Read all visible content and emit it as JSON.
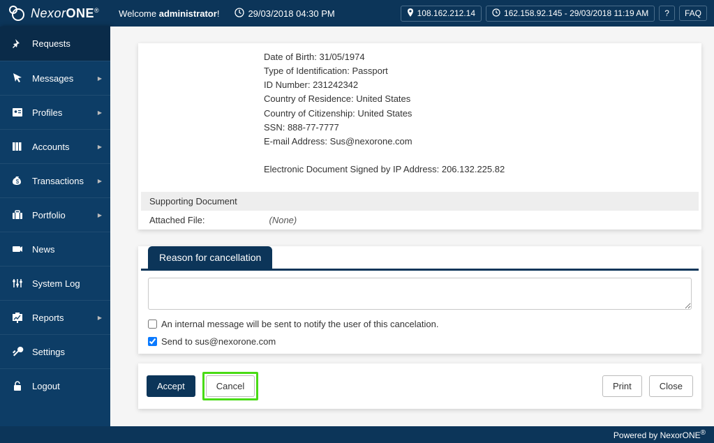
{
  "brand": {
    "name_a": "Nexor",
    "name_b": "ONE",
    "reg": "®"
  },
  "header": {
    "welcome_prefix": "Welcome ",
    "welcome_user": "administrator",
    "welcome_suffix": "!",
    "datetime": "29/03/2018 04:30 PM",
    "ip1": "108.162.212.14",
    "ip2": "162.158.92.145 - 29/03/2018 11:19 AM",
    "help": "?",
    "faq": "FAQ"
  },
  "sidebar": {
    "items": [
      {
        "label": "Requests",
        "icon": "thumbtack",
        "chevron": false,
        "active": true
      },
      {
        "label": "Messages",
        "icon": "cursor",
        "chevron": true,
        "active": false
      },
      {
        "label": "Profiles",
        "icon": "user-card",
        "chevron": true,
        "active": false
      },
      {
        "label": "Accounts",
        "icon": "books",
        "chevron": true,
        "active": false
      },
      {
        "label": "Transactions",
        "icon": "money-bag",
        "chevron": true,
        "active": false
      },
      {
        "label": "Portfolio",
        "icon": "suitcase",
        "chevron": true,
        "active": false
      },
      {
        "label": "News",
        "icon": "camera",
        "chevron": false,
        "active": false
      },
      {
        "label": "System Log",
        "icon": "sliders",
        "chevron": false,
        "active": false
      },
      {
        "label": "Reports",
        "icon": "chart",
        "chevron": true,
        "active": false
      },
      {
        "label": "Settings",
        "icon": "wrench",
        "chevron": false,
        "active": false
      },
      {
        "label": "Logout",
        "icon": "unlock",
        "chevron": false,
        "active": false
      }
    ]
  },
  "details": {
    "dob": "Date of Birth: 31/05/1974",
    "id_type": "Type of Identification: Passport",
    "id_number": "ID Number: 231242342",
    "residence": "Country of Residence: United States",
    "citizen": "Country of Citizenship: United States",
    "ssn": "SSN: 888-77-7777",
    "email": "E-mail Address: Sus@nexorone.com",
    "signed": "Electronic Document Signed by IP Address: 206.132.225.82"
  },
  "supporting": {
    "header": "Supporting Document",
    "label": "Attached File:",
    "value": "(None)"
  },
  "reason": {
    "tab": "Reason for cancellation",
    "textarea_value": "",
    "internal_checked": false,
    "internal_label": "An internal message will be sent to notify the user of this cancelation.",
    "sendto_checked": true,
    "sendto_label": "Send to sus@nexorone.com"
  },
  "actions": {
    "accept": "Accept",
    "cancel": "Cancel",
    "print": "Print",
    "close": "Close"
  },
  "footer": {
    "powered_prefix": "Powered by ",
    "powered_name": "NexorONE",
    "reg": "®"
  }
}
